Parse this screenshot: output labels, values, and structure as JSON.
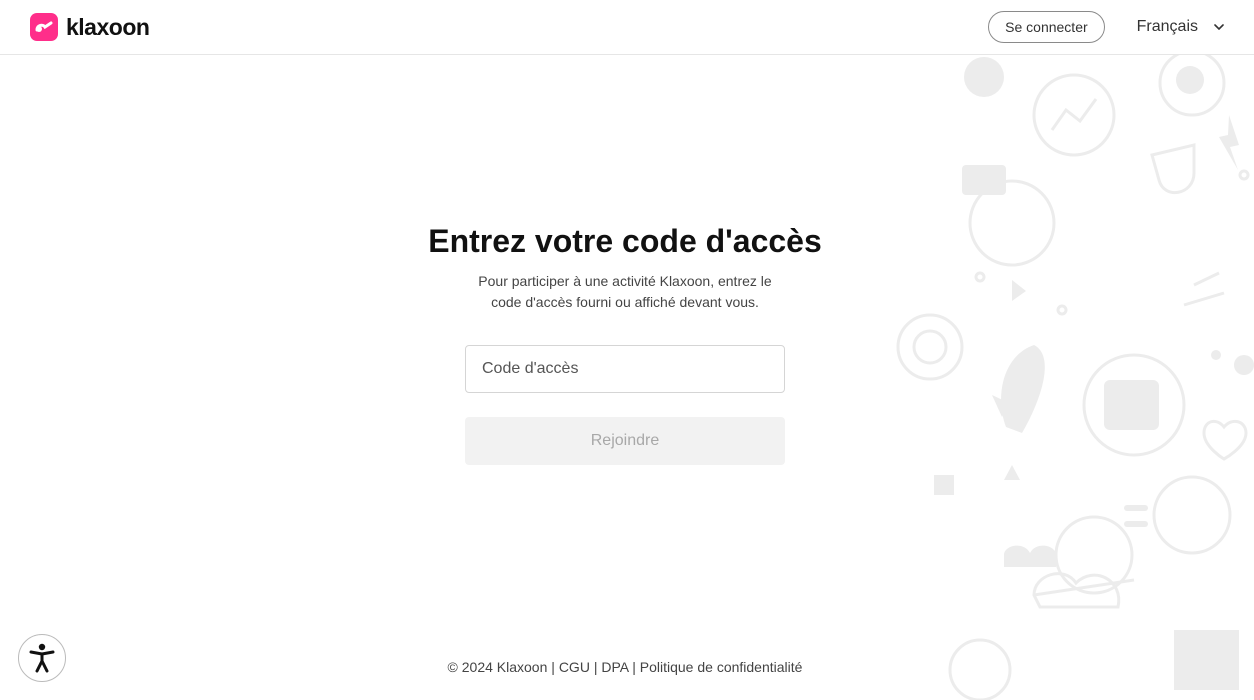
{
  "header": {
    "brand": "klaxoon",
    "connect_label": "Se connecter",
    "language": "Français"
  },
  "main": {
    "title": "Entrez votre code d'accès",
    "subtitle": "Pour participer à une activité Klaxoon, entrez le code d'accès fourni ou affiché devant vous.",
    "code_placeholder": "Code d'accès",
    "join_label": "Rejoindre"
  },
  "footer": {
    "copyright": "© 2024 Klaxoon",
    "links": [
      "CGU",
      "DPA",
      "Politique de confidentialité"
    ]
  },
  "colors": {
    "brand": "#ff2e8a",
    "disabled_button": "#f2f2f2",
    "pattern": "#ececec"
  },
  "icons": {
    "logo": "klaxoon-logo-icon",
    "language_toggle": "chevron-down-icon",
    "accessibility": "accessibility-icon"
  }
}
